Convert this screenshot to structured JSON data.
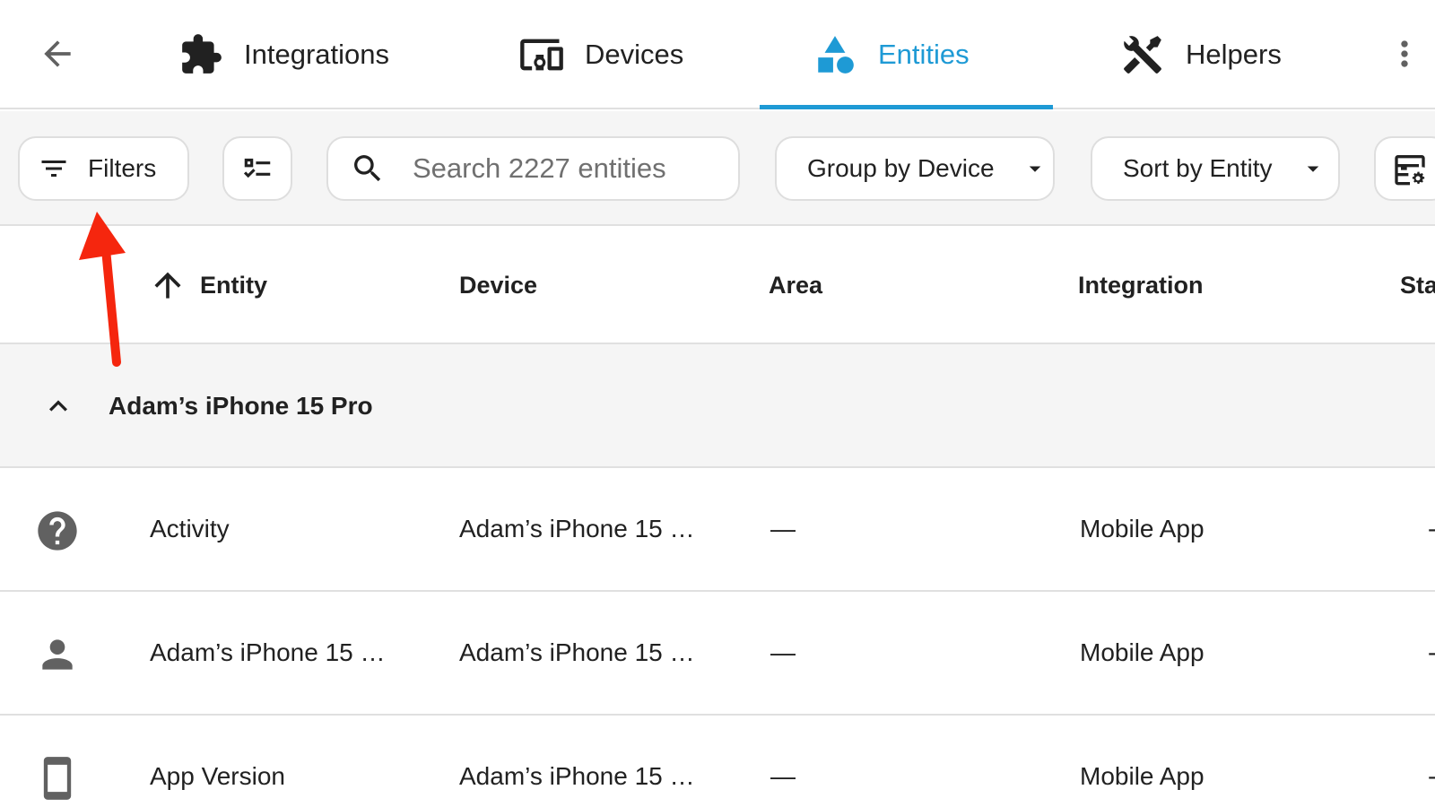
{
  "tabs": [
    {
      "label": "Integrations",
      "icon": "puzzle-icon"
    },
    {
      "label": "Devices",
      "icon": "devices-icon"
    },
    {
      "label": "Entities",
      "icon": "shapes-icon",
      "active": true
    },
    {
      "label": "Helpers",
      "icon": "tools-icon"
    }
  ],
  "toolbar": {
    "filters_label": "Filters",
    "search_placeholder": "Search 2227 entities",
    "group_by_label": "Group by Device",
    "sort_by_label": "Sort by Entity"
  },
  "table": {
    "columns": [
      "Entity",
      "Device",
      "Area",
      "Integration",
      "Sta"
    ],
    "sort_column": "Entity",
    "sort_direction": "ascending",
    "group": {
      "label": "Adam’s iPhone 15 Pro",
      "expanded": true
    },
    "rows": [
      {
        "icon": "help-circle-icon",
        "entity": "Activity",
        "device": "Adam’s iPhone 15 …",
        "area": "—",
        "integration": "Mobile App",
        "status": "-"
      },
      {
        "icon": "person-icon",
        "entity": "Adam’s iPhone 15 …",
        "device": "Adam’s iPhone 15 …",
        "area": "—",
        "integration": "Mobile App",
        "status": "-"
      },
      {
        "icon": "cellphone-icon",
        "entity": "App Version",
        "device": "Adam’s iPhone 15 …",
        "area": "—",
        "integration": "Mobile App",
        "status": "-"
      }
    ]
  },
  "colors": {
    "accent": "#1e9ad5",
    "annotation_arrow": "#f5260e",
    "toolbar_bg": "#f5f5f5",
    "divider": "#e0e0e0"
  }
}
